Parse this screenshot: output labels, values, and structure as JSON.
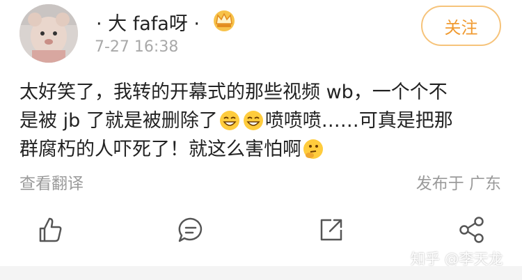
{
  "post": {
    "username": "· 大 fafa呀 ·",
    "time": "7-27 16:38",
    "follow_label": "关注",
    "content_lines": [
      [
        "太好笑了，我转的开幕式的那些视频 wb，一个个不"
      ],
      [
        "是被 jb 了就是被删除了",
        "喷喷喷……可真是把那"
      ],
      [
        "群腐朽的人吓死了！就这么害怕啊"
      ]
    ],
    "translate_label": "查看翻译",
    "location": "发布于 广东"
  },
  "actions": [
    "like-icon",
    "comment-icon",
    "repost-icon",
    "share-icon"
  ],
  "watermark": "知乎 @李天龙",
  "colors": {
    "accent": "#f09a30",
    "follow_border": "#f6c37a",
    "muted": "#9a9a9a"
  }
}
